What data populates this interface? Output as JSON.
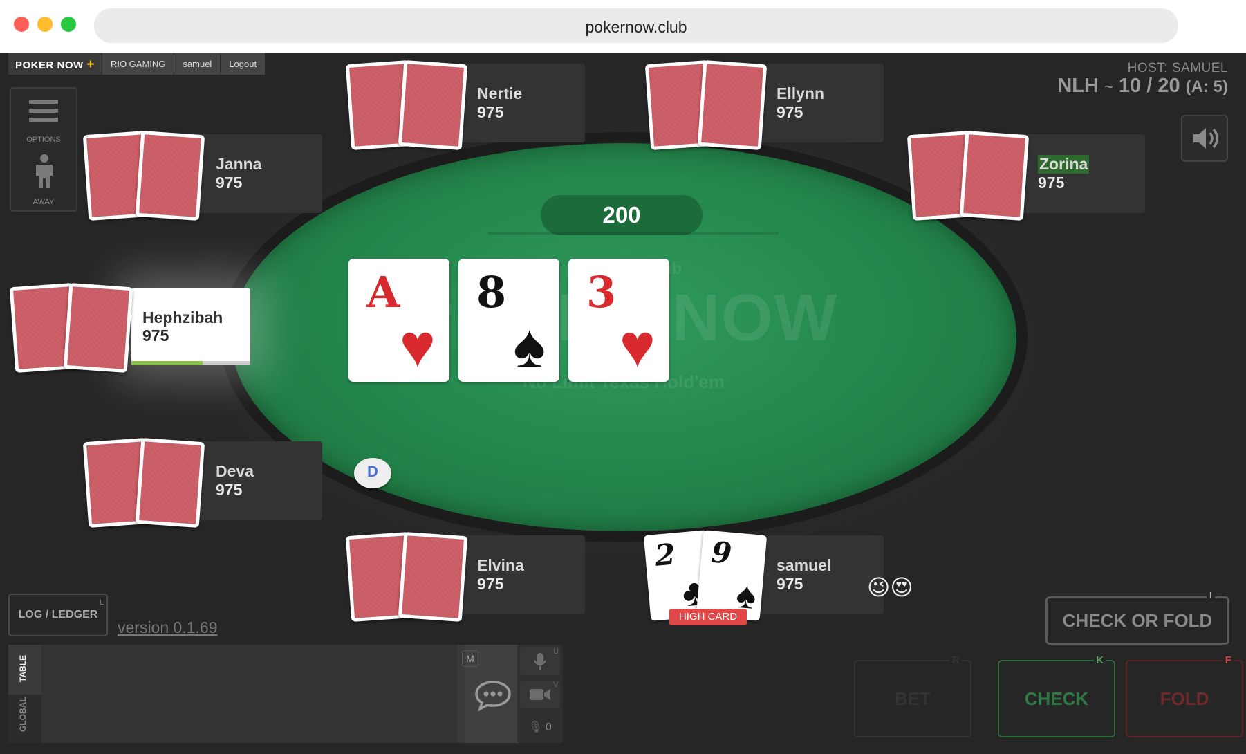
{
  "browser": {
    "url": "pokernow.club"
  },
  "nav": {
    "brand": "POKER NOW",
    "brand_plus": "+",
    "club": "RIO GAMING",
    "user": "samuel",
    "logout": "Logout"
  },
  "host": "HOST: SAMUEL",
  "stakes": {
    "game": "NLH",
    "sep": "~",
    "blinds": "10 / 20",
    "ante": "(A: 5)"
  },
  "sidebar": {
    "options_label": "OPTIONS",
    "away_label": "AWAY"
  },
  "table": {
    "pot": "200",
    "logo_domain": "pokernow.club",
    "logo_word": "POKER NOW",
    "logo_sub": "No Limit Texas Hold'em",
    "board": [
      {
        "rank": "A",
        "suit": "♥",
        "color": "#d82a2e"
      },
      {
        "rank": "8",
        "suit": "♠",
        "color": "#111111"
      },
      {
        "rank": "3",
        "suit": "♥",
        "color": "#d82a2e"
      }
    ],
    "dealer_button": "D"
  },
  "players": {
    "nertie": {
      "name": "Nertie",
      "stack": "975"
    },
    "ellynn": {
      "name": "Ellynn",
      "stack": "975"
    },
    "janna": {
      "name": "Janna",
      "stack": "975"
    },
    "zorina": {
      "name": "Zorina",
      "stack": "975"
    },
    "hephzibah": {
      "name": "Hephzibah",
      "stack": "975",
      "timer_remaining": 0.6
    },
    "deva": {
      "name": "Deva",
      "stack": "975"
    },
    "elvina": {
      "name": "Elvina",
      "stack": "975"
    },
    "samuel": {
      "name": "samuel",
      "stack": "975",
      "cards": [
        {
          "rank": "2",
          "suit": "♣"
        },
        {
          "rank": "9",
          "suit": "♠"
        }
      ],
      "hand_label": "HIGH CARD",
      "emoji": "😉😍"
    }
  },
  "controls": {
    "ledger": "LOG / LEDGER",
    "ledger_key": "L",
    "version": "version 0.1.69",
    "chat_tab_table": "TABLE",
    "chat_tab_global": "GLOBAL",
    "chat_key": "M",
    "mic_key": "U",
    "cam_key": "V",
    "listeners": "0",
    "check_or_fold": "CHECK OR FOLD",
    "check_or_fold_key": "I",
    "bet": "BET",
    "bet_key": "R",
    "check": "CHECK",
    "check_key": "K",
    "fold": "FOLD",
    "fold_key": "F"
  },
  "colors": {
    "felt": "#23844a",
    "check": "#2f7a44",
    "fold": "#d44444",
    "highlight_name": "#2f6b2f"
  }
}
